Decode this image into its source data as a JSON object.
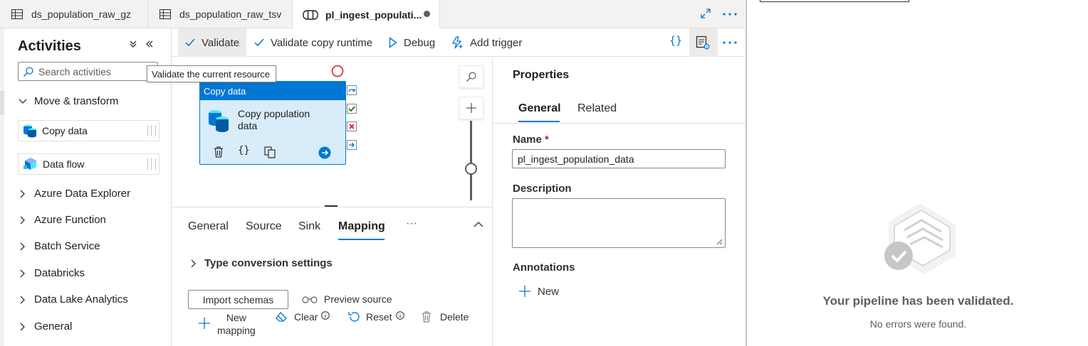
{
  "tabs": [
    {
      "label": "ds_population_raw_gz",
      "icon": "table-icon"
    },
    {
      "label": "ds_population_raw_tsv",
      "icon": "table-icon"
    },
    {
      "label": "pl_ingest_populati...",
      "icon": "pipeline-icon",
      "active": true
    }
  ],
  "activities": {
    "title": "Activities",
    "search_placeholder": "Search activities",
    "tooltip": "Validate the current resource",
    "move_transform": "Move & transform",
    "items": [
      {
        "label": "Copy data",
        "icon": "copy-data-icon"
      },
      {
        "label": "Data flow",
        "icon": "data-flow-icon"
      }
    ],
    "categories": [
      "Azure Data Explorer",
      "Azure Function",
      "Batch Service",
      "Databricks",
      "Data Lake Analytics",
      "General"
    ]
  },
  "toolbar": {
    "validate": "Validate",
    "validate_copy_runtime": "Validate copy runtime",
    "debug": "Debug",
    "add_trigger": "Add trigger"
  },
  "node": {
    "type": "Copy data",
    "name": "Copy population data",
    "name_line1": "Copy population",
    "name_line2": "data"
  },
  "bottom": {
    "tabs": [
      "General",
      "Source",
      "Sink",
      "Mapping"
    ],
    "active_tab": "Mapping",
    "more": "···",
    "type_conversion": "Type conversion settings",
    "import_schemas": "Import schemas",
    "preview_source": "Preview source",
    "new_mapping_line1": "New",
    "new_mapping_line2": "mapping",
    "clear": "Clear",
    "reset": "Reset",
    "delete": "Delete"
  },
  "properties": {
    "title": "Properties",
    "tabs": [
      "General",
      "Related"
    ],
    "active_tab": "General",
    "name_label": "Name",
    "required_mark": "*",
    "name_value": "pl_ingest_population_data",
    "description_label": "Description",
    "description_value": "",
    "annotations_label": "Annotations",
    "new_label": "New"
  },
  "validation": {
    "title": "Your pipeline has been validated.",
    "subtitle": "No errors were found."
  },
  "colors": {
    "accent": "#0078d4",
    "node_fill": "#d8ecfa",
    "error_circle": "#e81123",
    "success": "#107c10"
  }
}
